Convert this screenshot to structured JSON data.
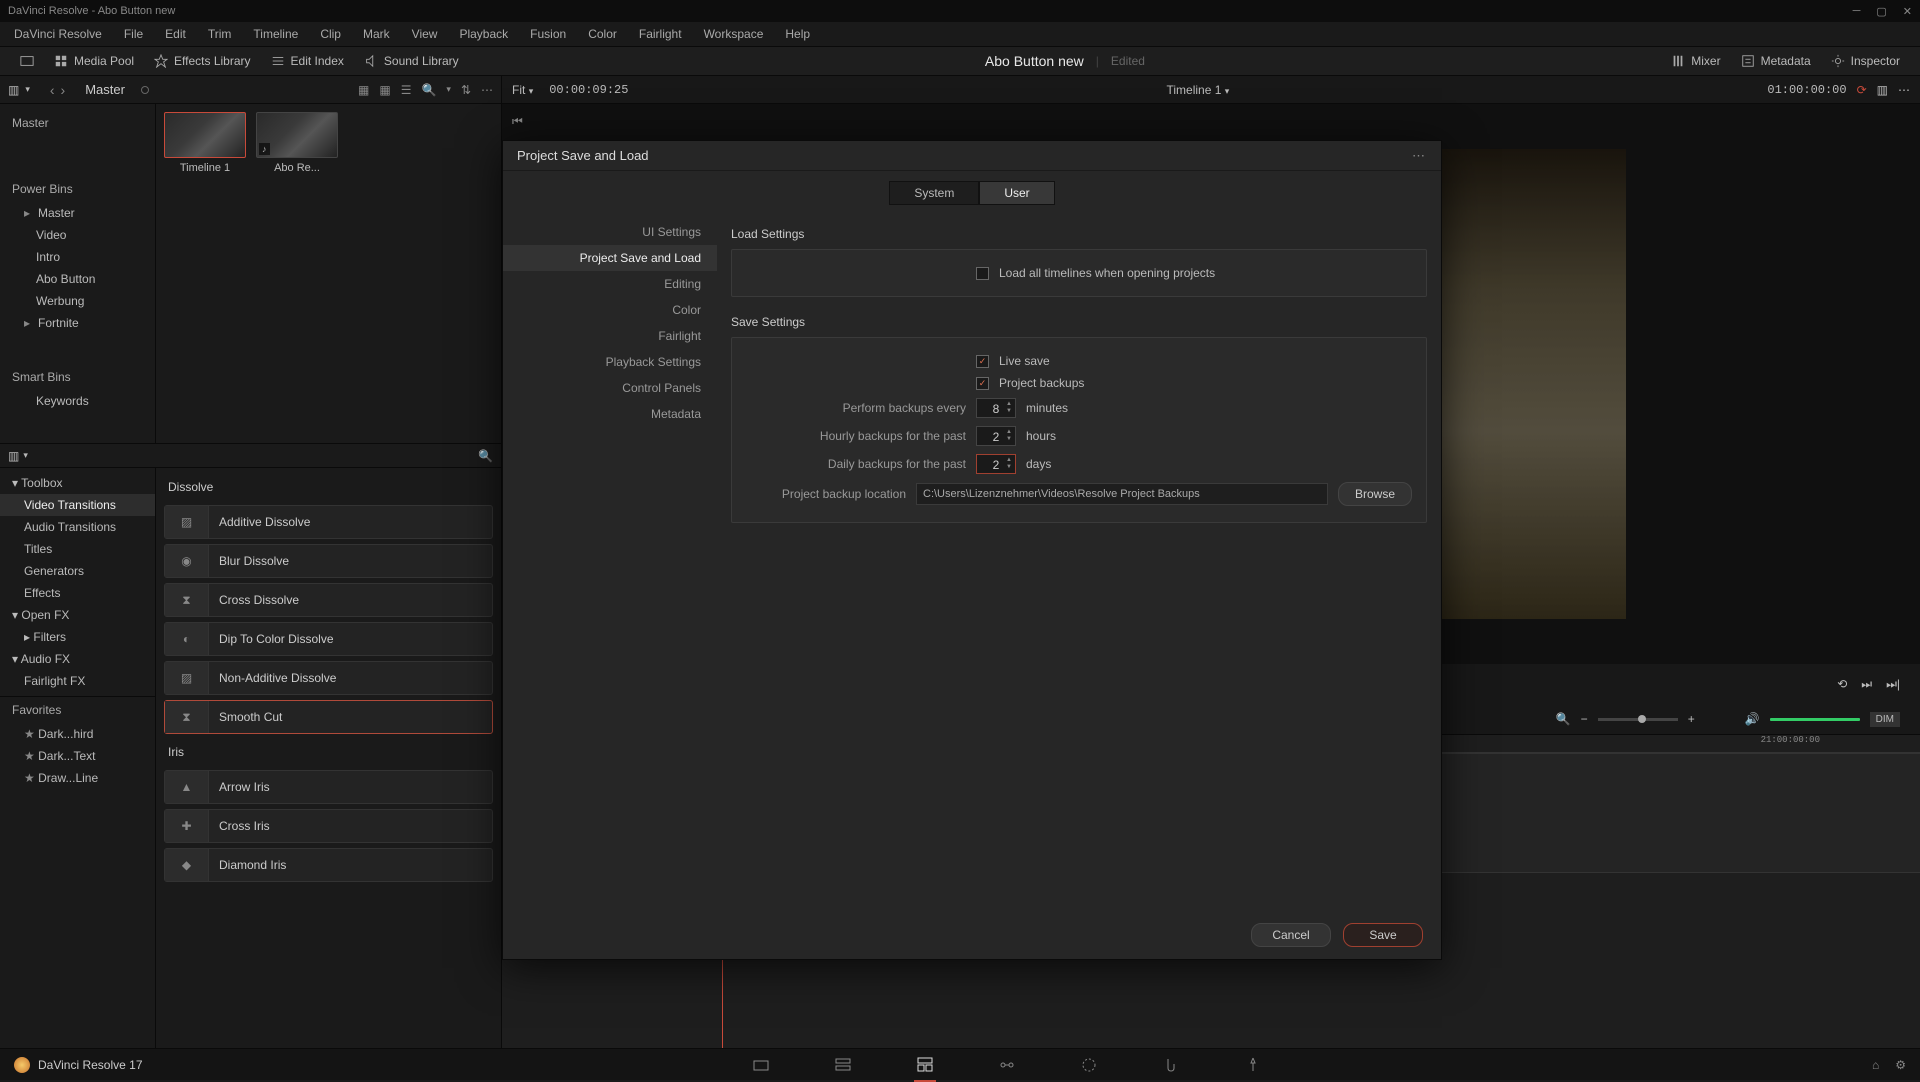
{
  "titlebar": {
    "app": "DaVinci Resolve",
    "project": "Abo Button new"
  },
  "menubar": [
    "DaVinci Resolve",
    "File",
    "Edit",
    "Trim",
    "Timeline",
    "Clip",
    "Mark",
    "View",
    "Playback",
    "Fusion",
    "Color",
    "Fairlight",
    "Workspace",
    "Help"
  ],
  "toolbar": {
    "left": [
      {
        "icon": "monitor-icon",
        "label": ""
      },
      {
        "icon": "media-icon",
        "label": "Media Pool"
      },
      {
        "icon": "fx-icon",
        "label": "Effects Library"
      },
      {
        "icon": "index-icon",
        "label": "Edit Index"
      },
      {
        "icon": "sound-icon",
        "label": "Sound Library"
      }
    ],
    "title": "Abo Button new",
    "edited": "Edited",
    "right": [
      {
        "icon": "mixer-icon",
        "label": "Mixer"
      },
      {
        "icon": "meta-icon",
        "label": "Metadata"
      },
      {
        "icon": "inspector-icon",
        "label": "Inspector"
      }
    ]
  },
  "browser": {
    "master": "Master",
    "tree": {
      "top": "Master",
      "pbins": "Power Bins",
      "items": [
        "Master",
        "Video",
        "Intro",
        "Abo Button",
        "Werbung",
        "Fortnite"
      ],
      "sbins": "Smart Bins",
      "sitems": [
        "Keywords"
      ]
    },
    "thumbs": [
      {
        "name": "Timeline 1",
        "sel": true
      },
      {
        "name": "Abo Re...",
        "sel": false
      }
    ]
  },
  "fx": {
    "tree": [
      {
        "label": "Toolbox",
        "h": true,
        "exp": "▾"
      },
      {
        "label": "Video Transitions",
        "sel": true
      },
      {
        "label": "Audio Transitions"
      },
      {
        "label": "Titles"
      },
      {
        "label": "Generators"
      },
      {
        "label": "Effects"
      },
      {
        "label": "Open FX",
        "h": true,
        "exp": "▾"
      },
      {
        "label": "Filters",
        "exp": "▸"
      },
      {
        "label": "Audio FX",
        "h": true,
        "exp": "▾"
      },
      {
        "label": "Fairlight FX"
      }
    ],
    "favorites": "Favorites",
    "favitems": [
      "Dark...hird",
      "Dark...Text",
      "Draw...Line"
    ],
    "groups": [
      {
        "name": "Dissolve",
        "items": [
          "Additive Dissolve",
          "Blur Dissolve",
          "Cross Dissolve",
          "Dip To Color Dissolve",
          "Non-Additive Dissolve",
          "Smooth Cut"
        ],
        "sel": 5
      },
      {
        "name": "Iris",
        "items": [
          "Arrow Iris",
          "Cross Iris",
          "Diamond Iris"
        ]
      }
    ]
  },
  "preview": {
    "fit": "Fit",
    "tc_left": "00:00:09:25",
    "timeline": "Timeline 1",
    "tc_right": "01:00:00:00"
  },
  "timeline": {
    "pos": "21:00:00:00"
  },
  "dialog": {
    "title": "Project Save and Load",
    "tabs": [
      "System",
      "User"
    ],
    "tab_sel": 1,
    "cats": [
      "UI Settings",
      "Project Save and Load",
      "Editing",
      "Color",
      "Fairlight",
      "Playback Settings",
      "Control Panels",
      "Metadata"
    ],
    "cat_sel": 1,
    "load_section": "Load Settings",
    "load_all": "Load all timelines when opening projects",
    "load_all_chk": false,
    "save_section": "Save Settings",
    "live_save": "Live save",
    "live_save_chk": true,
    "proj_backups": "Project backups",
    "proj_backups_chk": true,
    "perform": "Perform backups every",
    "perform_val": "8",
    "perform_unit": "minutes",
    "hourly": "Hourly backups for the past",
    "hourly_val": "2",
    "hourly_unit": "hours",
    "daily": "Daily backups for the past",
    "daily_val": "2",
    "daily_unit": "days",
    "daily_focus": true,
    "loc_label": "Project backup location",
    "loc_val": "C:\\Users\\Lizenznehmer\\Videos\\Resolve Project Backups",
    "browse": "Browse",
    "cancel": "Cancel",
    "save": "Save"
  },
  "bottombar": {
    "logo": "DaVinci Resolve 17",
    "pages": [
      "media",
      "cut",
      "edit",
      "fusion",
      "color",
      "fairlight",
      "deliver"
    ],
    "page_sel": 2
  },
  "audio": {
    "dim": "DIM"
  }
}
